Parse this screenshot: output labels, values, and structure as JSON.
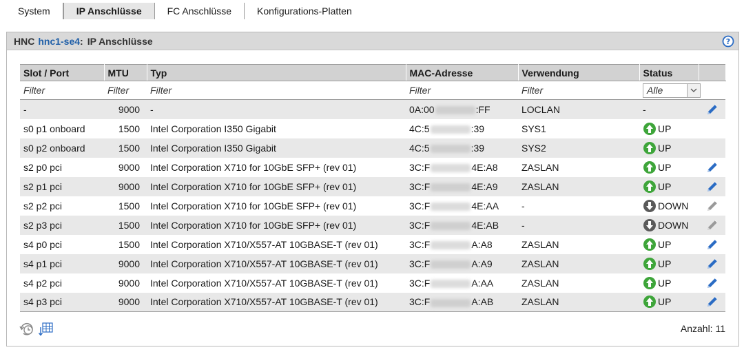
{
  "tabs": [
    {
      "label": "System",
      "active": false
    },
    {
      "label": "IP Anschlüsse",
      "active": true
    },
    {
      "label": "FC Anschlüsse",
      "active": false
    },
    {
      "label": "Konfigurations-Platten",
      "active": false
    }
  ],
  "panel": {
    "prefix": "HNC",
    "host_link": "hnc1-se4",
    "title": "IP Anschlüsse",
    "help_icon": "question-mark-circle-icon"
  },
  "columns": [
    "Slot / Port",
    "MTU",
    "Typ",
    "MAC-Adresse",
    "Verwendung",
    "Status",
    ""
  ],
  "filters": {
    "slot": "Filter",
    "mtu": "Filter",
    "typ": "Filter",
    "mac": "Filter",
    "verwendung": "Filter",
    "status_select": "Alle"
  },
  "rows": [
    {
      "slot": "-",
      "mtu": "9000",
      "typ": "-",
      "mac_prefix": "0A:00",
      "mac_suffix": ":FF",
      "verwendung": "LOCLAN",
      "status": "-",
      "status_kind": "none",
      "edit": "active"
    },
    {
      "slot": "s0 p1 onboard",
      "mtu": "1500",
      "typ": "Intel Corporation I350 Gigabit",
      "mac_prefix": "4C:5",
      "mac_suffix": ":39",
      "verwendung": "SYS1",
      "status": "UP",
      "status_kind": "up",
      "edit": "none"
    },
    {
      "slot": "s0 p2 onboard",
      "mtu": "1500",
      "typ": "Intel Corporation I350 Gigabit",
      "mac_prefix": "4C:5",
      "mac_suffix": ":39",
      "verwendung": "SYS2",
      "status": "UP",
      "status_kind": "up",
      "edit": "none"
    },
    {
      "slot": "s2 p0 pci",
      "mtu": "9000",
      "typ": "Intel Corporation X710 for 10GbE SFP+ (rev 01)",
      "mac_prefix": "3C:F",
      "mac_suffix": "4E:A8",
      "verwendung": "ZASLAN",
      "status": "UP",
      "status_kind": "up",
      "edit": "active"
    },
    {
      "slot": "s2 p1 pci",
      "mtu": "9000",
      "typ": "Intel Corporation X710 for 10GbE SFP+ (rev 01)",
      "mac_prefix": "3C:F",
      "mac_suffix": "4E:A9",
      "verwendung": "ZASLAN",
      "status": "UP",
      "status_kind": "up",
      "edit": "active"
    },
    {
      "slot": "s2 p2 pci",
      "mtu": "1500",
      "typ": "Intel Corporation X710 for 10GbE SFP+ (rev 01)",
      "mac_prefix": "3C:F",
      "mac_suffix": "4E:AA",
      "verwendung": "-",
      "status": "DOWN",
      "status_kind": "down",
      "edit": "disabled"
    },
    {
      "slot": "s2 p3 pci",
      "mtu": "1500",
      "typ": "Intel Corporation X710 for 10GbE SFP+ (rev 01)",
      "mac_prefix": "3C:F",
      "mac_suffix": "4E:AB",
      "verwendung": "-",
      "status": "DOWN",
      "status_kind": "down",
      "edit": "disabled"
    },
    {
      "slot": "s4 p0 pci",
      "mtu": "1500",
      "typ": "Intel Corporation X710/X557-AT 10GBASE-T (rev 01)",
      "mac_prefix": "3C:F",
      "mac_suffix": "A:A8",
      "verwendung": "ZASLAN",
      "status": "UP",
      "status_kind": "up",
      "edit": "active"
    },
    {
      "slot": "s4 p1 pci",
      "mtu": "9000",
      "typ": "Intel Corporation X710/X557-AT 10GBASE-T (rev 01)",
      "mac_prefix": "3C:F",
      "mac_suffix": "A:A9",
      "verwendung": "ZASLAN",
      "status": "UP",
      "status_kind": "up",
      "edit": "active"
    },
    {
      "slot": "s4 p2 pci",
      "mtu": "9000",
      "typ": "Intel Corporation X710/X557-AT 10GBASE-T (rev 01)",
      "mac_prefix": "3C:F",
      "mac_suffix": "A:AA",
      "verwendung": "ZASLAN",
      "status": "UP",
      "status_kind": "up",
      "edit": "active"
    },
    {
      "slot": "s4 p3 pci",
      "mtu": "9000",
      "typ": "Intel Corporation X710/X557-AT 10GBASE-T (rev 01)",
      "mac_prefix": "3C:F",
      "mac_suffix": "A:AB",
      "verwendung": "ZASLAN",
      "status": "UP",
      "status_kind": "up",
      "edit": "active"
    }
  ],
  "footer": {
    "count_label": "Anzahl: 11",
    "icons": [
      "refresh-clock-icon",
      "table-export-icon"
    ]
  },
  "colors": {
    "link": "#1f5fa8",
    "up_green": "#3ea53a",
    "down_gray": "#5a5a5a",
    "edit_blue": "#2b6cc4",
    "edit_disabled": "#9a9a9a",
    "header_bg": "#d2d2d2",
    "panel_header_bg": "#d9d9d9",
    "row_alt": "#e8e8e8"
  }
}
